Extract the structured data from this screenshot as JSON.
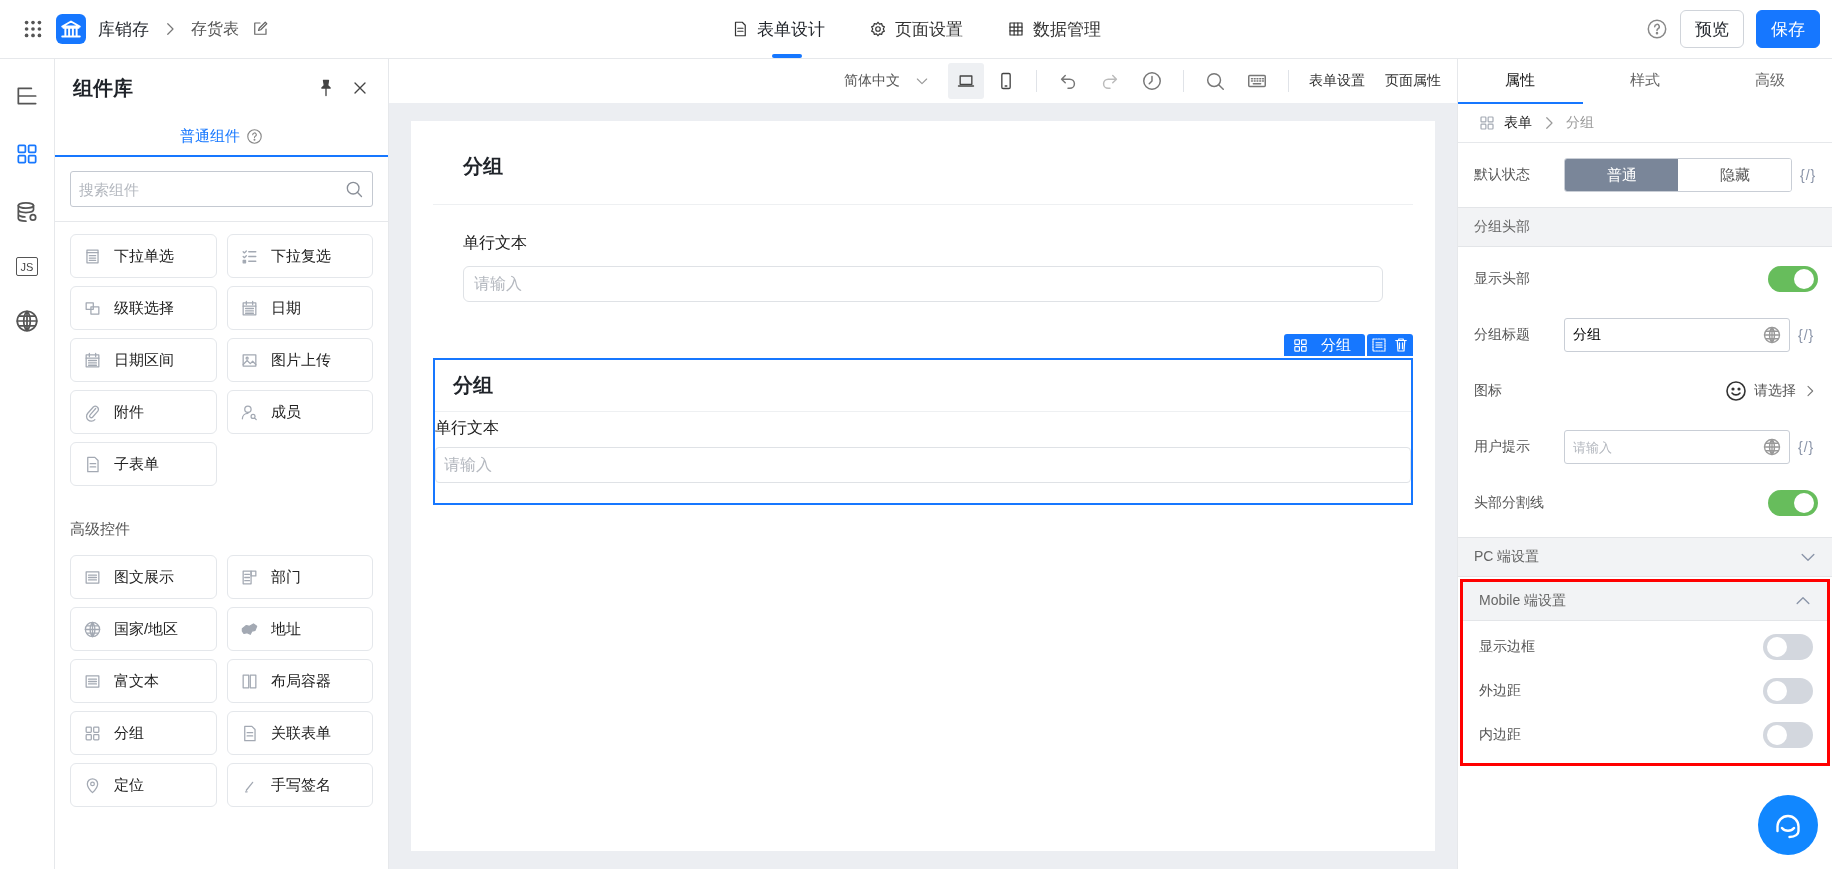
{
  "topbar": {
    "app_name": "库销存",
    "page_name": "存货表",
    "tabs": [
      {
        "label": "表单设计",
        "kind": "document",
        "selected": true
      },
      {
        "label": "页面设置",
        "kind": "gear",
        "selected": false
      },
      {
        "label": "数据管理",
        "kind": "table",
        "selected": false
      }
    ],
    "buttons": [
      {
        "label": "预览",
        "kind": "secondary"
      },
      {
        "label": "保存",
        "kind": "primary"
      }
    ]
  },
  "rail": [
    {
      "kind": "outline",
      "selected": false
    },
    {
      "kind": "grid",
      "selected": true
    },
    {
      "kind": "database",
      "selected": false
    },
    {
      "kind": "script",
      "label": "JS",
      "selected": false
    },
    {
      "kind": "globe",
      "selected": false
    }
  ],
  "library": {
    "title": "组件库",
    "tab": {
      "label": "普通组件",
      "selected": true
    },
    "search": {
      "placeholder": "搜索组件"
    },
    "groups": [
      {
        "items": [
          {
            "label": "下拉单选",
            "kind": "listbox"
          },
          {
            "label": "下拉复选",
            "kind": "checklist"
          },
          {
            "label": "级联选择",
            "kind": "cascade"
          },
          {
            "label": "日期",
            "kind": "calendar"
          },
          {
            "label": "日期区间",
            "kind": "calendar"
          },
          {
            "label": "图片上传",
            "kind": "image"
          },
          {
            "label": "附件",
            "kind": "paperclip"
          },
          {
            "label": "成员",
            "kind": "person"
          },
          {
            "label": "子表单",
            "kind": "document"
          }
        ]
      },
      {
        "title": "高级控件",
        "items": [
          {
            "label": "图文展示",
            "kind": "lines"
          },
          {
            "label": "部门",
            "kind": "department"
          },
          {
            "label": "国家/地区",
            "kind": "globe"
          },
          {
            "label": "地址",
            "kind": "map"
          },
          {
            "label": "富文本",
            "kind": "lines"
          },
          {
            "label": "布局容器",
            "kind": "columns"
          },
          {
            "label": "分组",
            "kind": "grid"
          },
          {
            "label": "关联表单",
            "kind": "document"
          },
          {
            "label": "定位",
            "kind": "pin"
          },
          {
            "label": "手写签名",
            "kind": "pen"
          }
        ]
      }
    ]
  },
  "toolbar": {
    "language": "简体中文",
    "devices": [
      {
        "kind": "laptop",
        "selected": true
      },
      {
        "kind": "phone",
        "selected": false
      }
    ],
    "links": [
      "表单设置",
      "页面属性"
    ]
  },
  "canvas": {
    "sections": [
      {
        "title": "分组",
        "selected": false,
        "fields": [
          {
            "label": "单行文本",
            "placeholder": "请输入"
          }
        ]
      },
      {
        "title": "分组",
        "selected": true,
        "badge": "分组",
        "fields": [
          {
            "label": "单行文本",
            "placeholder": "请输入"
          }
        ]
      }
    ]
  },
  "properties": {
    "tabs": [
      {
        "label": "属性",
        "selected": true
      },
      {
        "label": "样式",
        "selected": false
      },
      {
        "label": "高级",
        "selected": false
      }
    ],
    "breadcrumb": {
      "root": "表单",
      "current": "分组"
    },
    "default_state": {
      "label": "默认状态",
      "options": [
        {
          "label": "普通",
          "selected": true
        },
        {
          "label": "隐藏",
          "selected": false
        }
      ],
      "expression": "{/}"
    },
    "sections": [
      {
        "title": "分组头部",
        "highlighted": false,
        "rows": [
          {
            "kind": "toggle",
            "label": "显示头部",
            "on": true
          },
          {
            "kind": "input",
            "label": "分组标题",
            "value": "分组",
            "expression": "{/}"
          },
          {
            "kind": "picker",
            "label": "图标",
            "value": "请选择"
          },
          {
            "kind": "input",
            "label": "用户提示",
            "placeholder": "请输入",
            "expression": "{/}"
          },
          {
            "kind": "toggle",
            "label": "头部分割线",
            "on": true
          }
        ]
      },
      {
        "title": "PC 端设置",
        "expanded": false,
        "highlighted": false
      },
      {
        "title": "Mobile 端设置",
        "expanded": true,
        "highlighted": true,
        "rows": [
          {
            "kind": "toggle",
            "label": "显示边框",
            "on": false
          },
          {
            "kind": "toggle",
            "label": "外边距",
            "on": false
          },
          {
            "kind": "toggle",
            "label": "内边距",
            "on": false
          }
        ]
      }
    ]
  }
}
